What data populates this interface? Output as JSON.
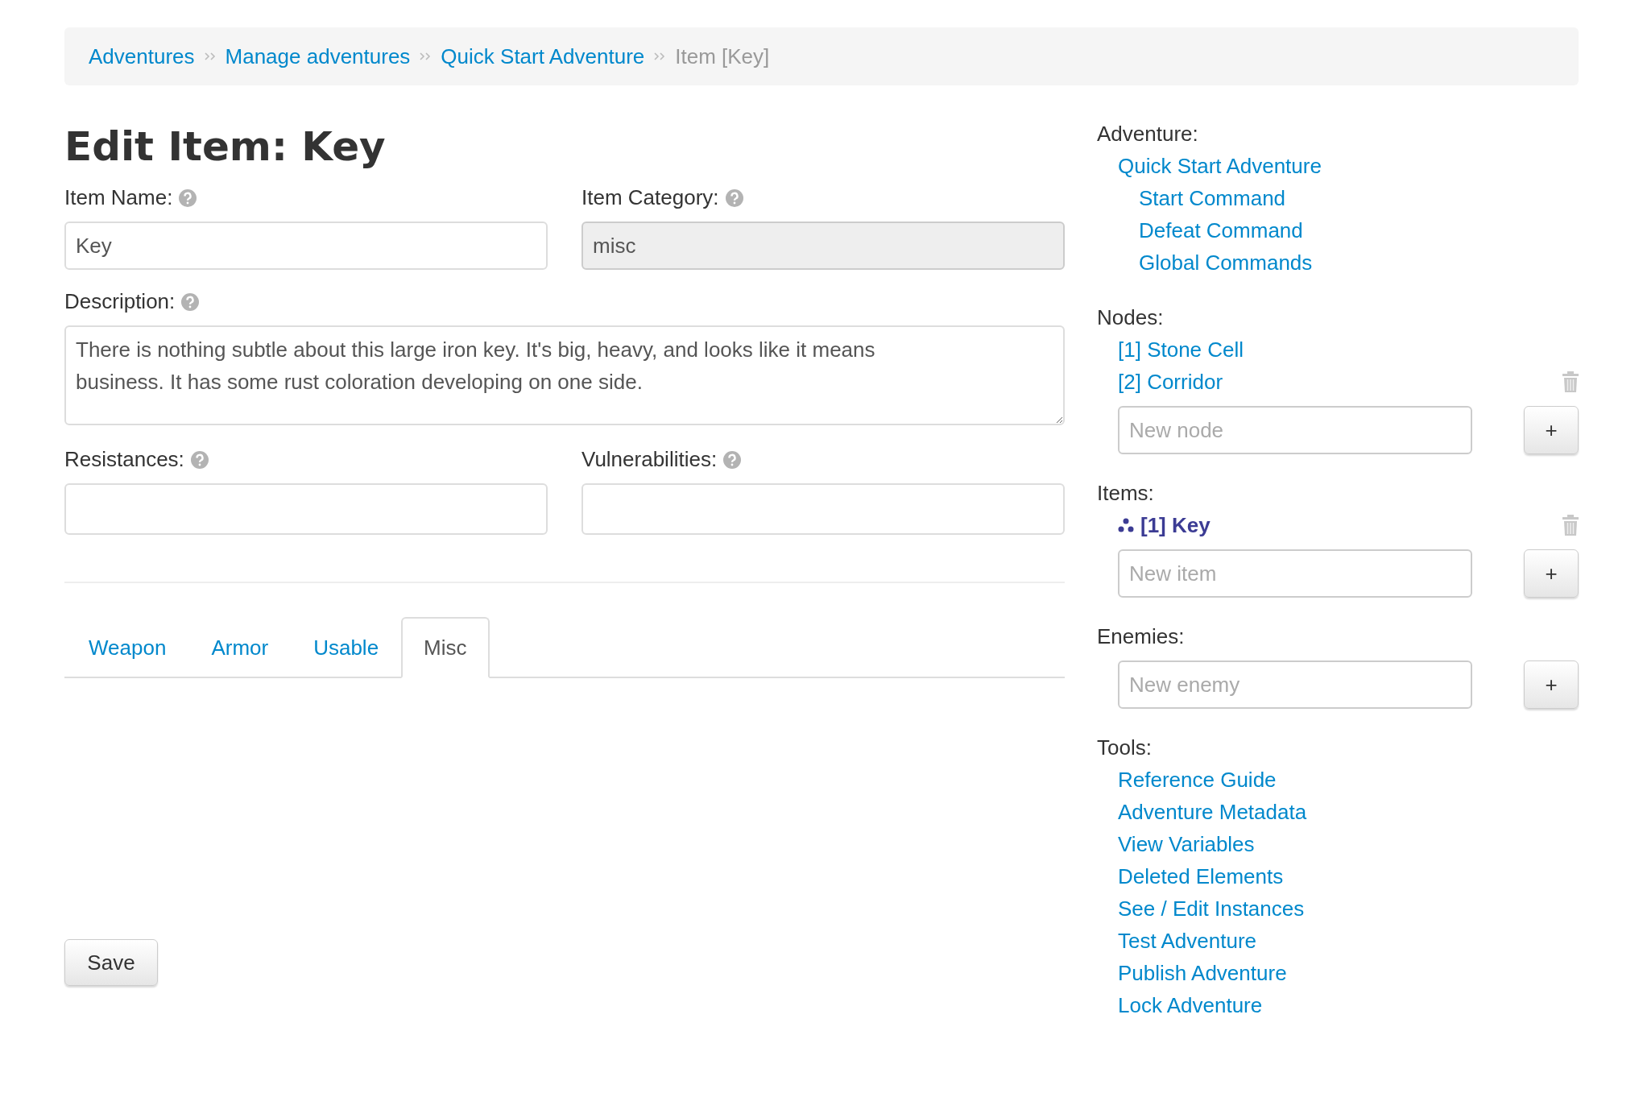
{
  "breadcrumb": [
    {
      "label": "Adventures",
      "current": false
    },
    {
      "label": "Manage adventures",
      "current": false
    },
    {
      "label": "Quick Start Adventure",
      "current": false
    },
    {
      "label": "Item [Key]",
      "current": true
    }
  ],
  "title": "Edit Item: Key",
  "form": {
    "name": {
      "label": "Item Name:",
      "value": "Key",
      "disabled": false
    },
    "category": {
      "label": "Item Category:",
      "value": "misc",
      "disabled": true
    },
    "description": {
      "label": "Description:",
      "value": "There is nothing subtle about this large iron key. It's big, heavy, and looks like it means business. It has some rust coloration developing on one side."
    },
    "resistances": {
      "label": "Resistances:"
    },
    "vulnerabilities": {
      "label": "Vulnerabilities:"
    }
  },
  "tabs": [
    {
      "label": "Weapon",
      "selected": false
    },
    {
      "label": "Armor",
      "selected": false
    },
    {
      "label": "Usable",
      "selected": false
    },
    {
      "label": "Misc",
      "selected": true
    }
  ],
  "save_button": "Save",
  "sidebar": {
    "adventure": {
      "heading": "Adventure:",
      "link": "Quick Start Adventure",
      "children": [
        "Start Command",
        "Defeat Command",
        "Global Commands"
      ]
    },
    "nodes": {
      "heading": "Nodes:",
      "items": [
        {
          "label": "[1] Stone Cell",
          "selected": false,
          "deletable": false
        },
        {
          "label": "[2] Corridor",
          "selected": false,
          "deletable": true
        }
      ],
      "placeholder": "New node",
      "add": "+"
    },
    "items": {
      "heading": "Items:",
      "items": [
        {
          "label": "[1] Key",
          "selected": true,
          "deletable": true
        }
      ],
      "placeholder": "New item",
      "add": "+"
    },
    "enemies": {
      "heading": "Enemies:",
      "placeholder": "New enemy",
      "add": "+"
    },
    "tools": {
      "heading": "Tools:",
      "links": [
        "Reference Guide",
        "Adventure Metadata",
        "View Variables",
        "Deleted Elements",
        "See / Edit Instances",
        "Test Adventure",
        "Publish Adventure",
        "Lock Adventure"
      ]
    }
  }
}
